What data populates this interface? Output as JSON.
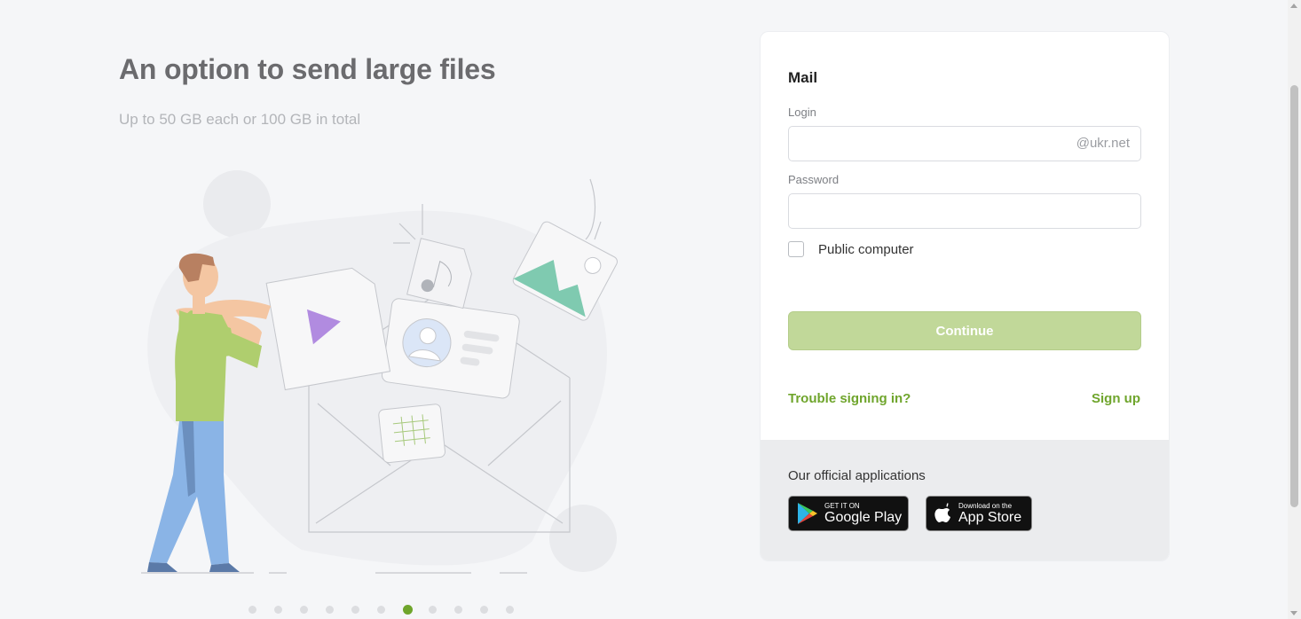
{
  "promo": {
    "title": "An option to send large files",
    "subtitle": "Up to 50 GB each or 100 GB in total",
    "slides_total": 11,
    "active_slide": 7
  },
  "login_card": {
    "title": "Mail",
    "login_label": "Login",
    "login_value": "",
    "domain_suffix": "@ukr.net",
    "password_label": "Password",
    "password_value": "",
    "public_computer_label": "Public computer",
    "public_computer_checked": false,
    "continue_label": "Continue",
    "trouble_link": "Trouble signing in?",
    "signup_link": "Sign up"
  },
  "apps": {
    "title": "Our official applications",
    "google_play": {
      "small": "GET IT ON",
      "big": "Google Play"
    },
    "app_store": {
      "small": "Download on the",
      "big": "App Store"
    }
  },
  "colors": {
    "accent": "#6fa52c",
    "button_disabled": "#c1d899",
    "background": "#f5f6f8"
  }
}
